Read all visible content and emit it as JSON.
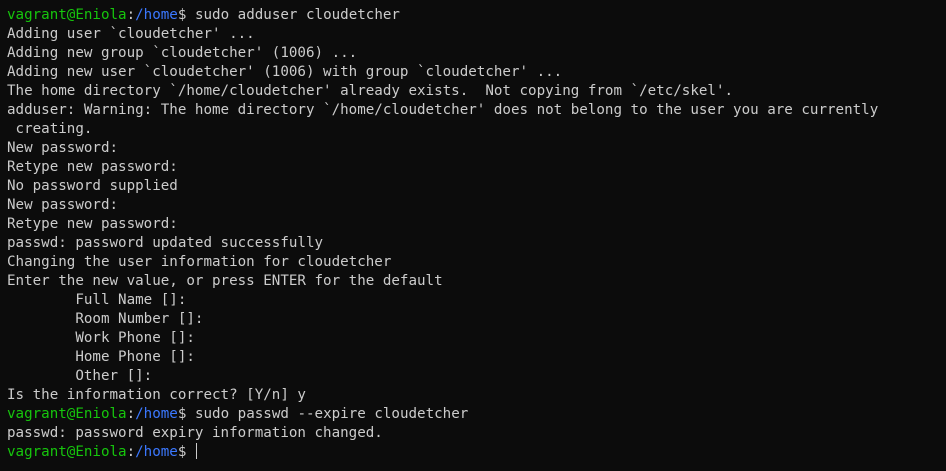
{
  "prompt": {
    "user_host": "vagrant@Eniola",
    "separator": ":",
    "path": "/home",
    "symbol": "$ "
  },
  "lines": [
    {
      "type": "prompt",
      "command": "sudo adduser cloudetcher"
    },
    {
      "type": "output",
      "text": "Adding user `cloudetcher' ..."
    },
    {
      "type": "output",
      "text": "Adding new group `cloudetcher' (1006) ..."
    },
    {
      "type": "output",
      "text": "Adding new user `cloudetcher' (1006) with group `cloudetcher' ..."
    },
    {
      "type": "output",
      "text": "The home directory `/home/cloudetcher' already exists.  Not copying from `/etc/skel'."
    },
    {
      "type": "output",
      "text": "adduser: Warning: The home directory `/home/cloudetcher' does not belong to the user you are currently"
    },
    {
      "type": "output",
      "text": " creating."
    },
    {
      "type": "output",
      "text": "New password:"
    },
    {
      "type": "output",
      "text": "Retype new password:"
    },
    {
      "type": "output",
      "text": "No password supplied"
    },
    {
      "type": "output",
      "text": "New password:"
    },
    {
      "type": "output",
      "text": "Retype new password:"
    },
    {
      "type": "output",
      "text": "passwd: password updated successfully"
    },
    {
      "type": "output",
      "text": "Changing the user information for cloudetcher"
    },
    {
      "type": "output",
      "text": "Enter the new value, or press ENTER for the default"
    },
    {
      "type": "output",
      "text": "        Full Name []:"
    },
    {
      "type": "output",
      "text": "        Room Number []:"
    },
    {
      "type": "output",
      "text": "        Work Phone []:"
    },
    {
      "type": "output",
      "text": "        Home Phone []:"
    },
    {
      "type": "output",
      "text": "        Other []:"
    },
    {
      "type": "output",
      "text": "Is the information correct? [Y/n] y"
    },
    {
      "type": "prompt",
      "command": "sudo passwd --expire cloudetcher"
    },
    {
      "type": "output",
      "text": "passwd: password expiry information changed."
    },
    {
      "type": "prompt",
      "command": "",
      "cursor": true
    }
  ],
  "colors": {
    "background": "#0c0c0c",
    "text": "#cccccc",
    "user_host": "#16c60c",
    "path": "#3b78ff"
  }
}
